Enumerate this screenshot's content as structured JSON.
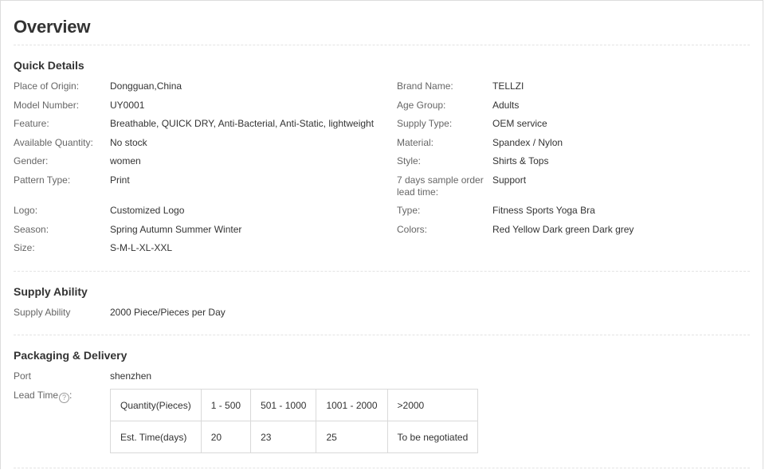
{
  "title": "Overview",
  "quick_details": {
    "heading": "Quick Details",
    "left": [
      {
        "label": "Place of Origin:",
        "value": "Dongguan,China"
      },
      {
        "label": "Model Number:",
        "value": "UY0001"
      },
      {
        "label": "Feature:",
        "value": "Breathable, QUICK DRY, Anti-Bacterial, Anti-Static, lightweight"
      },
      {
        "label": "Available Quantity:",
        "value": "No stock"
      },
      {
        "label": "Gender:",
        "value": "women"
      },
      {
        "label": "Pattern Type:",
        "value": "Print"
      },
      {
        "label": "Logo:",
        "value": "Customized Logo"
      },
      {
        "label": "Season:",
        "value": "Spring Autumn Summer Winter"
      },
      {
        "label": "Size:",
        "value": "S-M-L-XL-XXL"
      }
    ],
    "right": [
      {
        "label": "Brand Name:",
        "value": "TELLZI"
      },
      {
        "label": "Age Group:",
        "value": "Adults"
      },
      {
        "label": "Supply Type:",
        "value": "OEM service"
      },
      {
        "label": "Material:",
        "value": "Spandex / Nylon"
      },
      {
        "label": "Style:",
        "value": "Shirts & Tops"
      },
      {
        "label": "7 days sample order",
        "label2": "lead time:",
        "value": "Support"
      },
      {
        "label": "Type:",
        "value": "Fitness Sports Yoga Bra"
      },
      {
        "label": "Colors:",
        "value": "Red Yellow Dark green Dark grey"
      }
    ]
  },
  "supply_ability": {
    "heading": "Supply Ability",
    "label": "Supply Ability",
    "value": "2000 Piece/Pieces per Day"
  },
  "packaging": {
    "heading": "Packaging & Delivery",
    "port_label": "Port",
    "port_value": "shenzhen",
    "lead_time_label": "Lead Time",
    "lead_time_colon": ":",
    "help_icon": "?",
    "table": {
      "header": [
        "Quantity(Pieces)",
        "1 - 500",
        "501 - 1000",
        "1001 - 2000",
        ">2000"
      ],
      "row": [
        "Est. Time(days)",
        "20",
        "23",
        "25",
        "To be negotiated"
      ]
    }
  }
}
